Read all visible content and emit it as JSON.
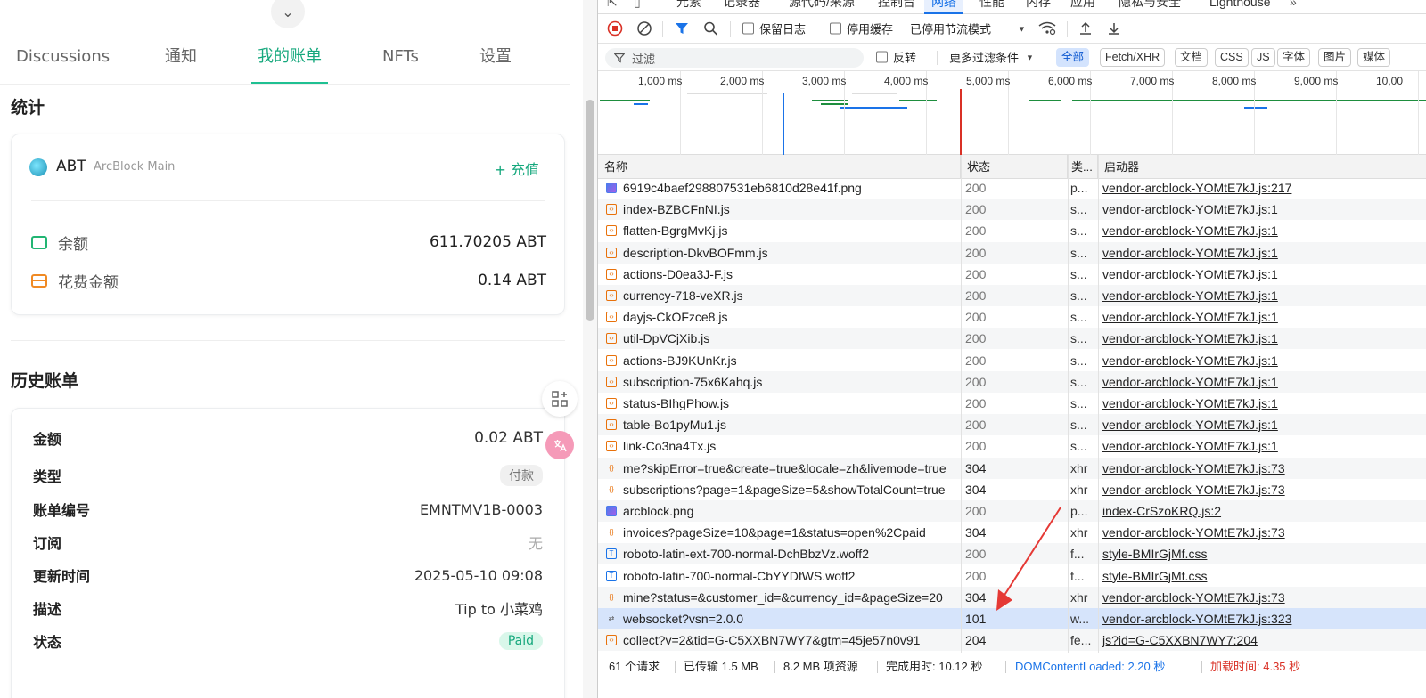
{
  "app": {
    "tabs": [
      {
        "label": "Discussions"
      },
      {
        "label": "通知"
      },
      {
        "label": "我的账单"
      },
      {
        "label": "NFTs"
      },
      {
        "label": "设置"
      }
    ],
    "stats": {
      "title": "统计",
      "token_symbol": "ABT",
      "chain_name": "ArcBlock Main",
      "topup_label": "+ 充值",
      "balance_label": "余额",
      "balance_value": "611.70205 ABT",
      "spent_label": "花费金额",
      "spent_value": "0.14 ABT"
    },
    "history": {
      "title": "历史账单",
      "amount_label": "金额",
      "amount_value": "0.02 ABT",
      "type_label": "类型",
      "type_value": "付款",
      "invoice_no_label": "账单编号",
      "invoice_no_value": "EMNTMV1B-0003",
      "subscription_label": "订阅",
      "subscription_value": "无",
      "updated_label": "更新时间",
      "updated_value": "2025-05-10 09:08",
      "desc_label": "描述",
      "desc_value": "Tip to 小菜鸡",
      "status_label": "状态",
      "status_value": "Paid"
    }
  },
  "devtools": {
    "tabs": [
      "元素",
      "记录器",
      "源代码/来源",
      "控制台",
      "网络",
      "性能",
      "内存",
      "应用",
      "隐私与安全",
      "Lighthouse"
    ],
    "toolbar": {
      "preserve_log": "保留日志",
      "disable_cache": "停用缓存",
      "throttling": "已停用节流模式"
    },
    "filter": {
      "placeholder": "过滤",
      "invert": "反转",
      "more_filters": "更多过滤条件",
      "types": [
        "全部",
        "Fetch/XHR",
        "文档",
        "CSS",
        "JS",
        "字体",
        "图片",
        "媒体"
      ]
    },
    "timeline_labels": [
      "1,000 ms",
      "2,000 ms",
      "3,000 ms",
      "4,000 ms",
      "5,000 ms",
      "6,000 ms",
      "7,000 ms",
      "8,000 ms",
      "9,000 ms",
      "10,00"
    ],
    "columns": {
      "name": "名称",
      "status": "状态",
      "type": "类...",
      "initiator": "启动器"
    },
    "requests": [
      {
        "name": "6919c4baef298807531eb6810d28e41f.png",
        "status": "200",
        "type": "p...",
        "initiator": "vendor-arcblock-YOMtE7kJ.js:217",
        "icon": "image"
      },
      {
        "name": "index-BZBCFnNI.js",
        "status": "200",
        "type": "s...",
        "initiator": "vendor-arcblock-YOMtE7kJ.js:1",
        "icon": "script"
      },
      {
        "name": "flatten-BgrgMvKj.js",
        "status": "200",
        "type": "s...",
        "initiator": "vendor-arcblock-YOMtE7kJ.js:1",
        "icon": "script"
      },
      {
        "name": "description-DkvBOFmm.js",
        "status": "200",
        "type": "s...",
        "initiator": "vendor-arcblock-YOMtE7kJ.js:1",
        "icon": "script"
      },
      {
        "name": "actions-D0ea3J-F.js",
        "status": "200",
        "type": "s...",
        "initiator": "vendor-arcblock-YOMtE7kJ.js:1",
        "icon": "script"
      },
      {
        "name": "currency-718-veXR.js",
        "status": "200",
        "type": "s...",
        "initiator": "vendor-arcblock-YOMtE7kJ.js:1",
        "icon": "script"
      },
      {
        "name": "dayjs-CkOFzce8.js",
        "status": "200",
        "type": "s...",
        "initiator": "vendor-arcblock-YOMtE7kJ.js:1",
        "icon": "script"
      },
      {
        "name": "util-DpVCjXib.js",
        "status": "200",
        "type": "s...",
        "initiator": "vendor-arcblock-YOMtE7kJ.js:1",
        "icon": "script"
      },
      {
        "name": "actions-BJ9KUnKr.js",
        "status": "200",
        "type": "s...",
        "initiator": "vendor-arcblock-YOMtE7kJ.js:1",
        "icon": "script"
      },
      {
        "name": "subscription-75x6Kahq.js",
        "status": "200",
        "type": "s...",
        "initiator": "vendor-arcblock-YOMtE7kJ.js:1",
        "icon": "script"
      },
      {
        "name": "status-BIhgPhow.js",
        "status": "200",
        "type": "s...",
        "initiator": "vendor-arcblock-YOMtE7kJ.js:1",
        "icon": "script"
      },
      {
        "name": "table-Bo1pyMu1.js",
        "status": "200",
        "type": "s...",
        "initiator": "vendor-arcblock-YOMtE7kJ.js:1",
        "icon": "script"
      },
      {
        "name": "link-Co3na4Tx.js",
        "status": "200",
        "type": "s...",
        "initiator": "vendor-arcblock-YOMtE7kJ.js:1",
        "icon": "script"
      },
      {
        "name": "me?skipError=true&create=true&locale=zh&livemode=true",
        "status": "304",
        "type": "xhr",
        "initiator": "vendor-arcblock-YOMtE7kJ.js:73",
        "icon": "xhr"
      },
      {
        "name": "subscriptions?page=1&pageSize=5&showTotalCount=true",
        "status": "304",
        "type": "xhr",
        "initiator": "vendor-arcblock-YOMtE7kJ.js:73",
        "icon": "xhr"
      },
      {
        "name": "arcblock.png",
        "status": "200",
        "type": "p...",
        "initiator": "index-CrSzoKRQ.js:2",
        "icon": "image"
      },
      {
        "name": "invoices?pageSize=10&page=1&status=open%2Cpaid",
        "status": "304",
        "type": "xhr",
        "initiator": "vendor-arcblock-YOMtE7kJ.js:73",
        "icon": "xhr"
      },
      {
        "name": "roboto-latin-ext-700-normal-DchBbzVz.woff2",
        "status": "200",
        "type": "f...",
        "initiator": "style-BMIrGjMf.css",
        "icon": "font"
      },
      {
        "name": "roboto-latin-700-normal-CbYYDfWS.woff2",
        "status": "200",
        "type": "f...",
        "initiator": "style-BMIrGjMf.css",
        "icon": "font"
      },
      {
        "name": "mine?status=&customer_id=&currency_id=&pageSize=20",
        "status": "304",
        "type": "xhr",
        "initiator": "vendor-arcblock-YOMtE7kJ.js:73",
        "icon": "xhr"
      },
      {
        "name": "websocket?vsn=2.0.0",
        "status": "101",
        "type": "w...",
        "initiator": "vendor-arcblock-YOMtE7kJ.js:323",
        "icon": "websocket"
      },
      {
        "name": "collect?v=2&tid=G-C5XXBN7WY7&gtm=45je57n0v91",
        "status": "204",
        "type": "fe...",
        "initiator": "js?id=G-C5XXBN7WY7:204",
        "icon": "script"
      }
    ],
    "status_bar": {
      "requests": "61 个请求",
      "transferred": "已传输 1.5 MB",
      "resources": "8.2 MB 项资源",
      "finish": "完成用时: 10.12 秒",
      "dcl": "DOMContentLoaded: 2.20 秒",
      "load": "加载时间: 4.35 秒"
    },
    "colors": {
      "accent": "#1a73e8",
      "dcl": "#1a73e8",
      "load": "#d93025"
    }
  },
  "colors": {
    "brand_green": "#1fc092",
    "paid_bg": "#d9f7ea"
  }
}
